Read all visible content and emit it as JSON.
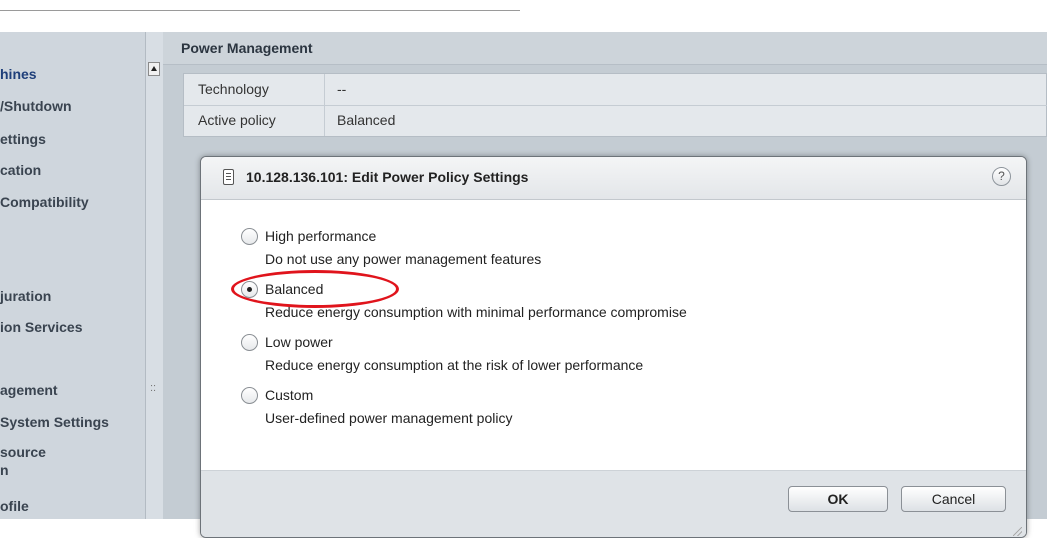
{
  "sidebar": {
    "items": [
      {
        "label": "hines",
        "selected": true
      },
      {
        "label": "/Shutdown",
        "selected": false
      },
      {
        "label": "ettings",
        "selected": false
      },
      {
        "label": "cation",
        "selected": false
      },
      {
        "label": "Compatibility",
        "selected": false
      },
      {
        "label": "juration",
        "selected": false
      },
      {
        "label": "ion Services",
        "selected": false
      },
      {
        "label": "agement",
        "selected": false
      },
      {
        "label": "System Settings",
        "selected": false
      },
      {
        "label": "source",
        "selected": false
      },
      {
        "label": "n",
        "selected": false
      },
      {
        "label": "ofile",
        "selected": false
      }
    ],
    "grip": "::"
  },
  "main": {
    "section_title": "Power Management",
    "properties": [
      {
        "key": "Technology",
        "value": "--"
      },
      {
        "key": "Active policy",
        "value": "Balanced"
      }
    ]
  },
  "dialog": {
    "title": "10.128.136.101: Edit Power Policy Settings",
    "help_icon": "?",
    "options": [
      {
        "label": "High performance",
        "description": "Do not use any power management features",
        "checked": false
      },
      {
        "label": "Balanced",
        "description": "Reduce energy consumption with minimal performance compromise",
        "checked": true
      },
      {
        "label": "Low power",
        "description": "Reduce energy consumption at the risk of lower performance",
        "checked": false
      },
      {
        "label": "Custom",
        "description": "User-defined power management policy",
        "checked": false
      }
    ],
    "ok_label": "OK",
    "cancel_label": "Cancel"
  },
  "colors": {
    "highlight_ring": "#e0141c",
    "sidebar_bg": "#cfd6dd",
    "panel_bg": "#c4ccd3",
    "footer_bg": "#dfe3e7"
  }
}
